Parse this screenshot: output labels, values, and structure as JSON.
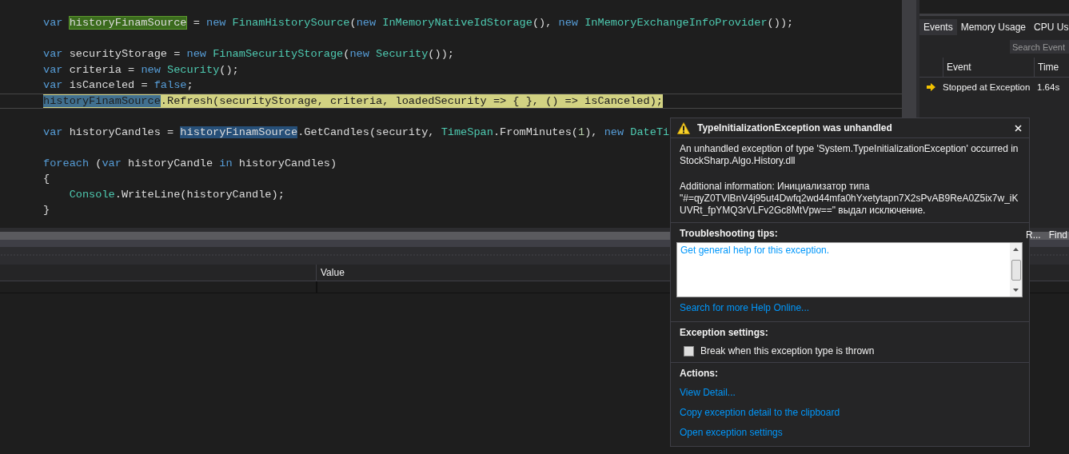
{
  "editor": {
    "lines": [
      {
        "kind": "code",
        "tokens": [
          {
            "text": "var ",
            "kind": "keyword"
          },
          {
            "text": "historyFinamSource",
            "kind": "definition"
          },
          {
            "text": " = ",
            "kind": "plain"
          },
          {
            "text": "new ",
            "kind": "keyword"
          },
          {
            "text": "FinamHistorySource",
            "kind": "type"
          },
          {
            "text": "(",
            "kind": "plain"
          },
          {
            "text": "new ",
            "kind": "keyword"
          },
          {
            "text": "InMemoryNativeIdStorage",
            "kind": "type"
          },
          {
            "text": "(), ",
            "kind": "plain"
          },
          {
            "text": "new ",
            "kind": "keyword"
          },
          {
            "text": "InMemoryExchangeInfoProvider",
            "kind": "type"
          },
          {
            "text": "());",
            "kind": "plain"
          }
        ],
        "current": false
      },
      {
        "kind": "blank"
      },
      {
        "kind": "code",
        "tokens": [
          {
            "text": "var",
            "kind": "keyword"
          },
          {
            "text": " securityStorage = ",
            "kind": "plain"
          },
          {
            "text": "new ",
            "kind": "keyword"
          },
          {
            "text": "FinamSecurityStorage",
            "kind": "type"
          },
          {
            "text": "(",
            "kind": "plain"
          },
          {
            "text": "new ",
            "kind": "keyword"
          },
          {
            "text": "Security",
            "kind": "type"
          },
          {
            "text": "());",
            "kind": "plain"
          }
        ],
        "current": false
      },
      {
        "kind": "code",
        "tokens": [
          {
            "text": "var",
            "kind": "keyword"
          },
          {
            "text": " criteria = ",
            "kind": "plain"
          },
          {
            "text": "new ",
            "kind": "keyword"
          },
          {
            "text": "Security",
            "kind": "type"
          },
          {
            "text": "();",
            "kind": "plain"
          }
        ],
        "current": false
      },
      {
        "kind": "code",
        "tokens": [
          {
            "text": "var",
            "kind": "keyword"
          },
          {
            "text": " isCanceled = ",
            "kind": "plain"
          },
          {
            "text": "false",
            "kind": "keyword"
          },
          {
            "text": ";",
            "kind": "plain"
          }
        ],
        "current": false
      },
      {
        "kind": "code",
        "tokens": [
          {
            "text": "historyFinamSource",
            "kind": "reference"
          },
          {
            "text": ".Refresh(securityStorage, criteria, loadedSecurity => { }, () => isCanceled);",
            "kind": "plain"
          }
        ],
        "current": true
      },
      {
        "kind": "blank"
      },
      {
        "kind": "code",
        "tokens": [
          {
            "text": "var",
            "kind": "keyword"
          },
          {
            "text": " historyCandles = ",
            "kind": "plain"
          },
          {
            "text": "historyFinamSource",
            "kind": "reference"
          },
          {
            "text": ".GetCandles(security, ",
            "kind": "plain"
          },
          {
            "text": "TimeSpan",
            "kind": "type"
          },
          {
            "text": ".FromMinutes(",
            "kind": "plain"
          },
          {
            "text": "1",
            "kind": "number"
          },
          {
            "text": "), ",
            "kind": "plain"
          },
          {
            "text": "new ",
            "kind": "keyword"
          },
          {
            "text": "DateTi",
            "kind": "type"
          }
        ],
        "current": false
      },
      {
        "kind": "blank"
      },
      {
        "kind": "code",
        "tokens": [
          {
            "text": "foreach",
            "kind": "keyword"
          },
          {
            "text": " (",
            "kind": "plain"
          },
          {
            "text": "var",
            "kind": "keyword"
          },
          {
            "text": " historyCandle ",
            "kind": "plain"
          },
          {
            "text": "in",
            "kind": "keyword"
          },
          {
            "text": " historyCandles)",
            "kind": "plain"
          }
        ],
        "current": false
      },
      {
        "kind": "code",
        "tokens": [
          {
            "text": "{",
            "kind": "plain"
          }
        ],
        "current": false
      },
      {
        "kind": "code",
        "tokens": [
          {
            "text": "    Console",
            "kind": "type"
          },
          {
            "text": ".WriteLine(historyCandle);",
            "kind": "plain"
          }
        ],
        "current": false
      },
      {
        "kind": "code",
        "tokens": [
          {
            "text": "}",
            "kind": "plain"
          }
        ],
        "current": false
      }
    ]
  },
  "diagnostic_tools": {
    "tabs": [
      {
        "label": "Events",
        "selected": true
      },
      {
        "label": "Memory Usage",
        "selected": false
      },
      {
        "label": "CPU Us",
        "selected": false
      }
    ],
    "search": {
      "placeholder": "Search Event"
    },
    "columns": [
      "Event",
      "Time"
    ],
    "rows": [
      {
        "event": "Stopped at Exception",
        "time": "1.64s"
      }
    ]
  },
  "bottom_tabs": [
    "R...",
    "Find"
  ],
  "locals": {
    "columns": [
      "Value"
    ]
  },
  "exception_popup": {
    "title": "TypeInitializationException was unhandled",
    "message": "An unhandled exception of type 'System.TypeInitializationException' occurred in StockSharp.Algo.History.dll",
    "additional_info": "Additional information: Инициализатор типа \"#=qyZ0TVlBnV4j95ut4Dwfq2wd44mfa0hYxetytapn7X2sPvAB9ReA0Z5ix7w_iKUVRt_fpYMQ3rVLFv2Gc8MtVpw==\" выдал исключение.",
    "tips_title": "Troubleshooting tips:",
    "tips": [
      "Get general help for this exception."
    ],
    "help_link": "Search for more Help Online...",
    "settings_title": "Exception settings:",
    "break_option": {
      "label": "Break when this exception type is thrown",
      "checked": false
    },
    "actions_title": "Actions:",
    "actions": [
      "View Detail...",
      "Copy exception detail to the clipboard",
      "Open exception settings"
    ]
  }
}
